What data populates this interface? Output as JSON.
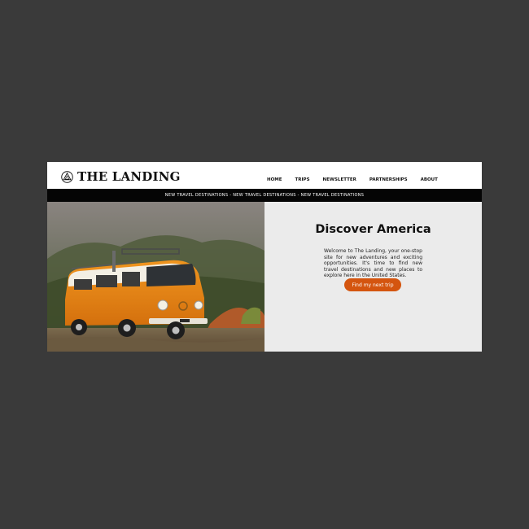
{
  "brand": {
    "name": "THE LANDING",
    "icon": "triangle-logo-icon"
  },
  "nav": {
    "items": [
      {
        "label": "HOME"
      },
      {
        "label": "TRIPS"
      },
      {
        "label": "NEWSLETTER"
      },
      {
        "label": "PARTNERSHIPS"
      },
      {
        "label": "ABOUT"
      }
    ]
  },
  "ticker": {
    "text": "NEW TRAVEL DESTINATIONS - NEW TRAVEL DESTINATIONS - NEW TRAVEL DESTINATIONS"
  },
  "hero": {
    "title": "Discover America",
    "body": "Welcome to The Landing, your one-stop site for new adventures and exciting opportunities. It's time to find new travel destinations and new places to explore here in the United States.",
    "cta_label": "Find my next trip",
    "image_subject": "orange-vw-van-photo"
  },
  "colors": {
    "accent": "#d4550f",
    "ticker_bg": "#050505",
    "panel_bg": "#ebebeb",
    "backdrop": "#3a3a3a"
  }
}
